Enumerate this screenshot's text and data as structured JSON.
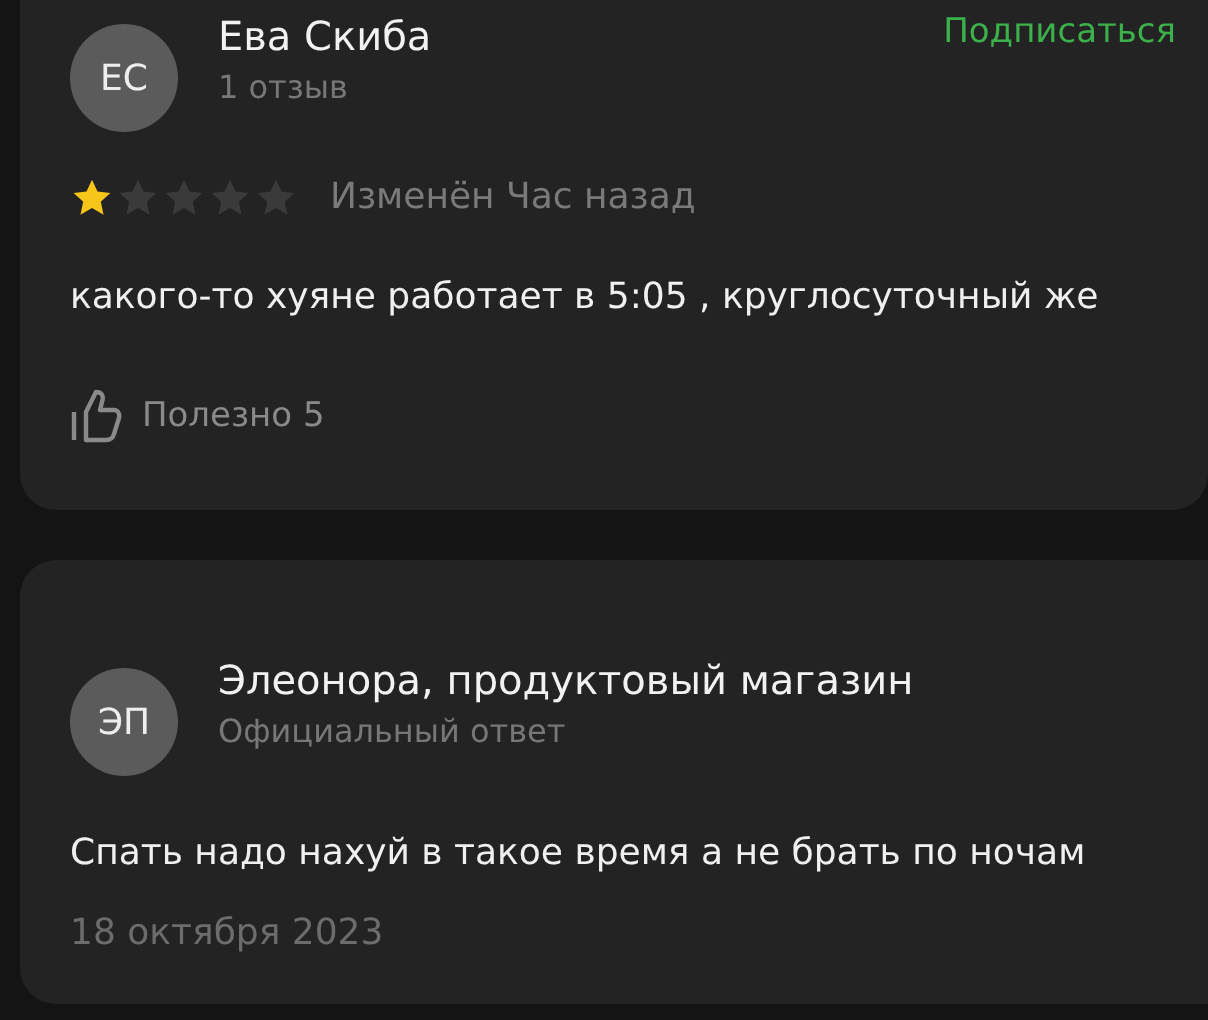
{
  "review": {
    "avatar": "ЕС",
    "author": "Ева Скиба",
    "subtitle": "1 отзыв",
    "subscribe": "Подписаться",
    "stars": 1,
    "edited": "Изменён Час назад",
    "text": "какого-то хуяне работает в 5:05 , круглосуточный же",
    "helpful": "Полезно 5"
  },
  "reply": {
    "avatar": "ЭП",
    "author": "Элеонора, продуктовый магазин",
    "subtitle": "Официальный ответ",
    "text": "Спать надо нахуй в такое время а не брать по ночам",
    "date": "18 октября 2023"
  }
}
